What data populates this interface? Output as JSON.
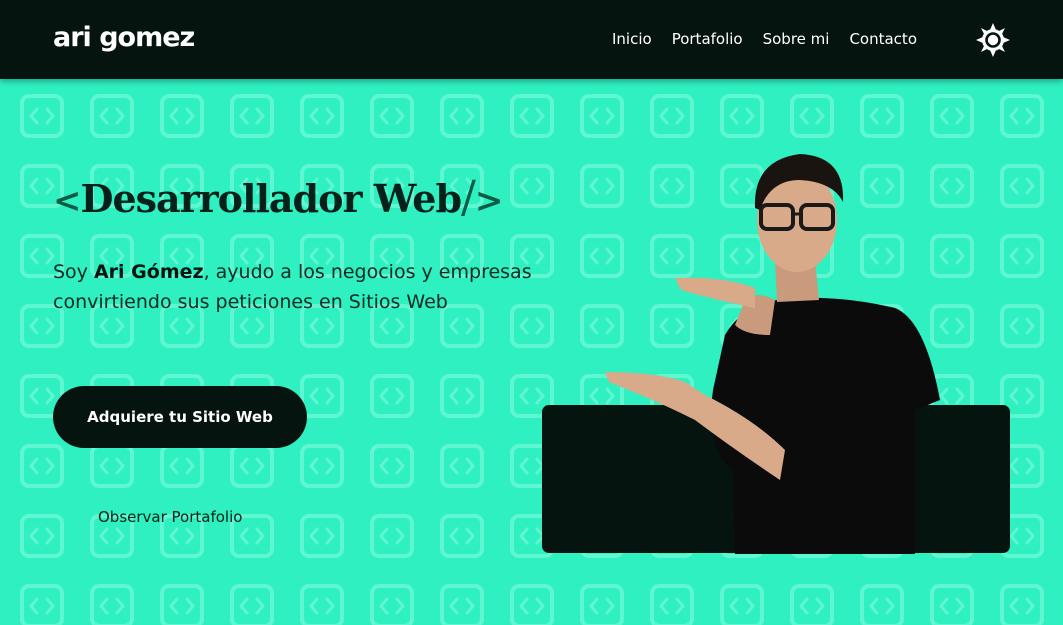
{
  "header": {
    "logo": "ari gomez",
    "nav": [
      "Inicio",
      "Portafolio",
      "Sobre mi",
      "Contacto"
    ],
    "theme_icon": "sun-gear-icon"
  },
  "hero": {
    "title_open": "<",
    "title": "Desarrollador Web",
    "title_slash": "/",
    "title_close": ">",
    "desc_prefix": "Soy ",
    "desc_name": "Ari Gómez",
    "desc_suffix": ", ayudo a los negocios y empresas convirtiendo sus peticiones en Sitios Web",
    "cta_primary": "Adquiere tu Sitio Web",
    "cta_secondary": "Observar Portafolio"
  },
  "colors": {
    "accent": "#2ef0c0",
    "dark": "#06140f"
  }
}
